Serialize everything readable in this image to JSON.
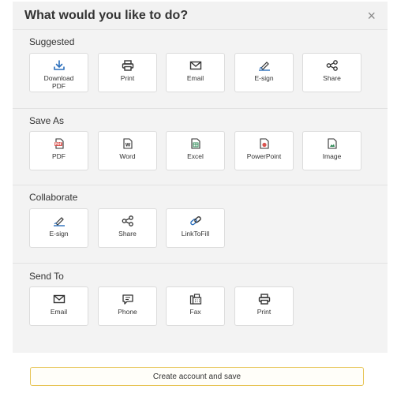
{
  "dialog": {
    "title": "What would you like to do?",
    "close_label": "×"
  },
  "sections": {
    "suggested": {
      "title": "Suggested",
      "items": [
        {
          "label": "Download\nPDF",
          "icon": "download-icon"
        },
        {
          "label": "Print",
          "icon": "printer-icon"
        },
        {
          "label": "Email",
          "icon": "envelope-icon"
        },
        {
          "label": "E-sign",
          "icon": "signature-icon"
        },
        {
          "label": "Share",
          "icon": "share-icon"
        }
      ]
    },
    "save_as": {
      "title": "Save As",
      "items": [
        {
          "label": "PDF",
          "icon": "pdf-file-icon"
        },
        {
          "label": "Word",
          "icon": "word-file-icon"
        },
        {
          "label": "Excel",
          "icon": "excel-file-icon"
        },
        {
          "label": "PowerPoint",
          "icon": "powerpoint-file-icon"
        },
        {
          "label": "Image",
          "icon": "image-file-icon"
        }
      ]
    },
    "collaborate": {
      "title": "Collaborate",
      "items": [
        {
          "label": "E-sign",
          "icon": "signature-icon"
        },
        {
          "label": "Share",
          "icon": "share-icon"
        },
        {
          "label": "LinkToFill",
          "icon": "link-icon"
        }
      ]
    },
    "send_to": {
      "title": "Send To",
      "items": [
        {
          "label": "Email",
          "icon": "envelope-icon"
        },
        {
          "label": "Phone",
          "icon": "chat-icon"
        },
        {
          "label": "Fax",
          "icon": "fax-icon"
        },
        {
          "label": "Print",
          "icon": "printer-icon"
        }
      ]
    }
  },
  "footer": {
    "cta_label": "Create account and save"
  },
  "colors": {
    "accent": "#2a6ebb",
    "pdf_red": "#d9534f",
    "excel_green": "#2e8b57",
    "cta_border": "#e7c455"
  }
}
